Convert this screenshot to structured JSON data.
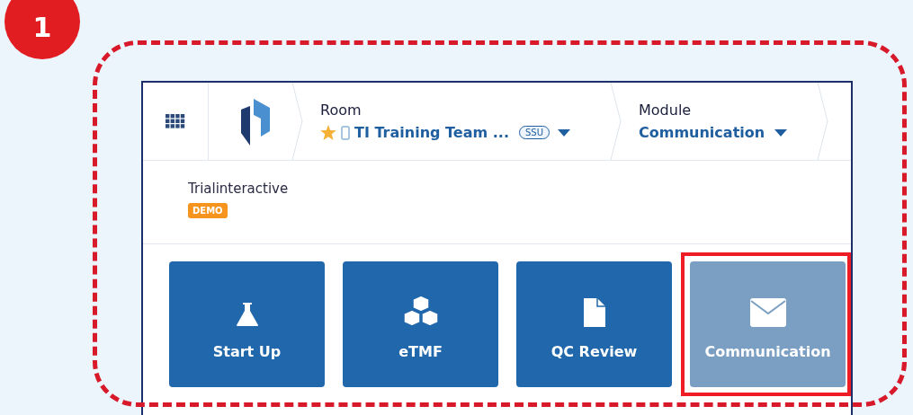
{
  "step_badge": "1",
  "header": {
    "room": {
      "label": "Room",
      "starred": true,
      "name": "TI Training Team ...",
      "tag": "SSU"
    },
    "module": {
      "label": "Module",
      "name": "Communication"
    }
  },
  "brand": {
    "name": "Trialinteractive",
    "badge": "DEMO"
  },
  "tiles": [
    {
      "kind": "flask",
      "label": "Start Up",
      "selected": false
    },
    {
      "kind": "cubes",
      "label": "eTMF",
      "selected": false
    },
    {
      "kind": "file",
      "label": "QC Review",
      "selected": false
    },
    {
      "kind": "mail",
      "label": "Communication",
      "selected": true
    }
  ]
}
